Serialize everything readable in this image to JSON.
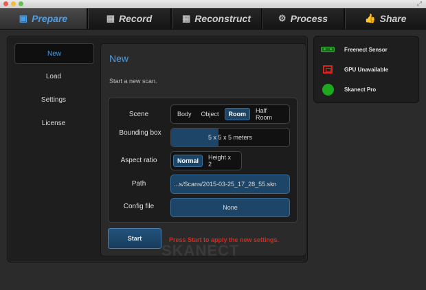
{
  "tabs": [
    {
      "label": "Prepare",
      "icon": "prepare-icon",
      "glyph": "▣",
      "active": true
    },
    {
      "label": "Record",
      "icon": "film-icon",
      "glyph": "▦",
      "active": false
    },
    {
      "label": "Reconstruct",
      "icon": "film-icon",
      "glyph": "▦",
      "active": false
    },
    {
      "label": "Process",
      "icon": "gears-icon",
      "glyph": "⚙",
      "active": false
    },
    {
      "label": "Share",
      "icon": "thumbs-up-icon",
      "glyph": "👍",
      "active": false
    }
  ],
  "sidebar": {
    "items": [
      {
        "label": "New",
        "active": true
      },
      {
        "label": "Load",
        "active": false
      },
      {
        "label": "Settings",
        "active": false
      },
      {
        "label": "License",
        "active": false
      }
    ]
  },
  "page": {
    "title": "New",
    "subtitle": "Start a new scan."
  },
  "form": {
    "scene": {
      "label": "Scene",
      "options": [
        "Body",
        "Object",
        "Room",
        "Half Room"
      ],
      "selected": "Room"
    },
    "bounding_box": {
      "label": "Bounding box",
      "value": "5 x 5 x 5 meters",
      "fill_fraction": 0.4
    },
    "aspect_ratio": {
      "label": "Aspect ratio",
      "options": [
        "Normal",
        "Height x 2"
      ],
      "selected": "Normal"
    },
    "path": {
      "label": "Path",
      "value": "...s/Scans/2015-03-25_17_28_55.skn"
    },
    "config_file": {
      "label": "Config file",
      "value": "None"
    }
  },
  "actions": {
    "start_label": "Start",
    "hint": "Press Start to apply the new settings."
  },
  "watermark": "SKANECT",
  "status": [
    {
      "label": "Freenect Sensor",
      "icon": "sensor-icon",
      "state": "ok",
      "color": "#39b539"
    },
    {
      "label": "GPU Unavailable",
      "icon": "gpu-icon",
      "state": "error",
      "color": "#d9241b"
    },
    {
      "label": "Skanect Pro",
      "icon": "license-icon",
      "state": "ok",
      "color": "#1fa81f"
    }
  ],
  "colors": {
    "accent": "#4b9ee8",
    "selected": "#1c4568",
    "error": "#d52a1f"
  }
}
